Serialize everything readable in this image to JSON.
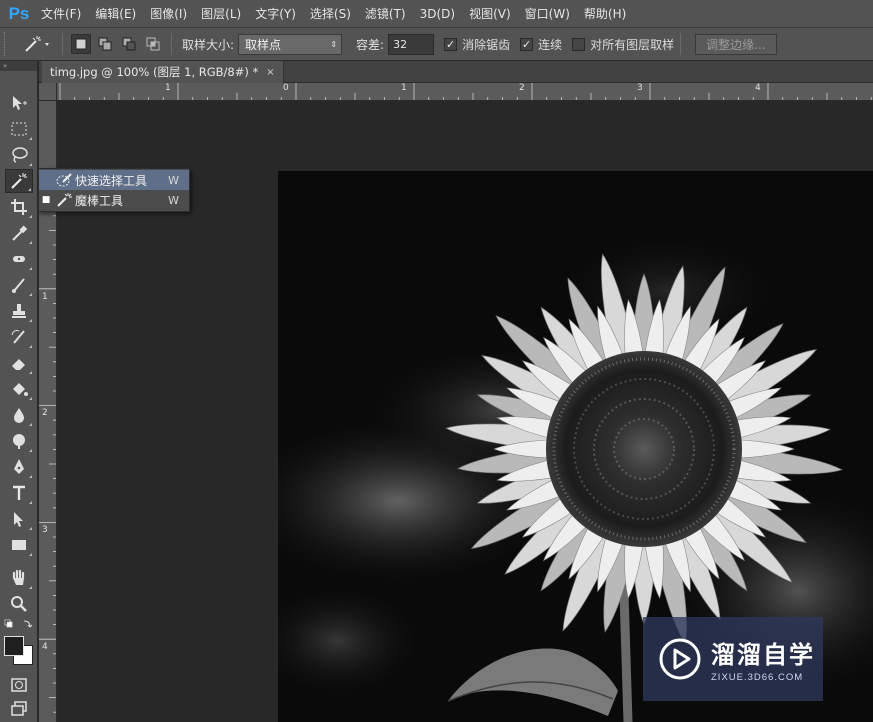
{
  "app": {
    "logo": "Ps"
  },
  "menu": [
    "文件(F)",
    "编辑(E)",
    "图像(I)",
    "图层(L)",
    "文字(Y)",
    "选择(S)",
    "滤镜(T)",
    "3D(D)",
    "视图(V)",
    "窗口(W)",
    "帮助(H)"
  ],
  "options": {
    "sample_size_label": "取样大小:",
    "sample_size_value": "取样点",
    "tolerance_label": "容差:",
    "tolerance_value": "32",
    "antialias_label": "消除锯齿",
    "antialias_checked": true,
    "contiguous_label": "连续",
    "contiguous_checked": true,
    "all_layers_label": "对所有图层取样",
    "all_layers_checked": false,
    "refine_edge_label": "调整边缘..."
  },
  "document": {
    "tab_title": "timg.jpg @ 100% (图层 1, RGB/8#) *",
    "close": "×"
  },
  "ruler": {
    "top_labels": [
      "1",
      "0",
      "1",
      "2",
      "3",
      "4"
    ],
    "left_labels": [
      "1",
      "2",
      "3",
      "4"
    ]
  },
  "flyout": {
    "items": [
      {
        "label": "快速选择工具",
        "shortcut": "W",
        "icon": "quick-selection-icon",
        "highlighted": true,
        "current": false
      },
      {
        "label": "魔棒工具",
        "shortcut": "W",
        "icon": "magic-wand-icon",
        "highlighted": false,
        "current": true
      }
    ]
  },
  "tools": [
    "move-icon",
    "marquee-icon",
    "lasso-icon",
    "magic-wand-icon",
    "crop-icon",
    "eyedropper-icon",
    "healing-brush-icon",
    "brush-icon",
    "clone-stamp-icon",
    "history-brush-icon",
    "eraser-icon",
    "paint-bucket-icon",
    "blur-icon",
    "dodge-icon",
    "pen-icon",
    "type-icon",
    "path-selection-icon",
    "rectangle-icon",
    "hand-icon",
    "zoom-icon"
  ],
  "colors": {
    "foreground": "#1f1f1f",
    "background": "#ffffff",
    "panel": "#535353",
    "accent": "#31a8ff"
  },
  "watermark": {
    "title": "溜溜自学",
    "subtitle": "ZIXUE.3D66.COM"
  }
}
